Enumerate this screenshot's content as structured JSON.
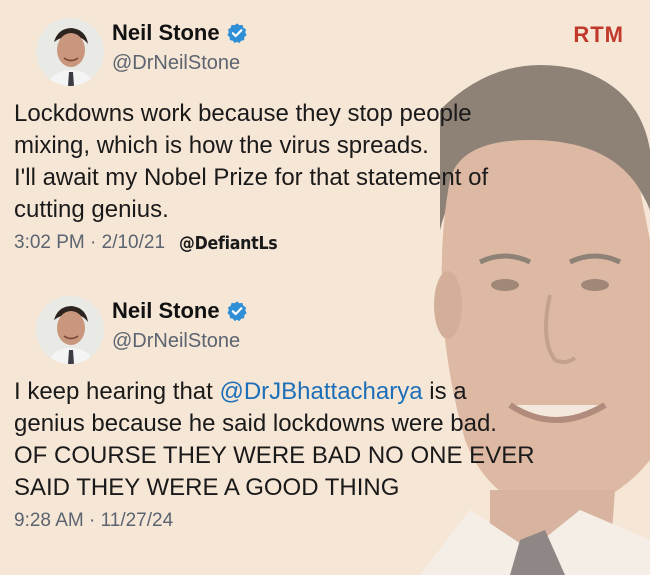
{
  "watermark": "RTM",
  "credit": "@DefiantLs",
  "colors": {
    "background": "#f6e6d6",
    "mention": "#1d6fb8",
    "verified_badge": "#2e8fd6",
    "watermark": "#c0392b",
    "secondary_text": "#5b6470"
  },
  "tweets": [
    {
      "author": {
        "name": "Neil Stone",
        "handle": "@DrNeilStone",
        "verified_icon": "verified-badge-icon"
      },
      "lines": [
        "Lockdowns work because they stop people",
        "mixing, which is how the virus spreads.",
        "I'll await my Nobel Prize for that statement of",
        "cutting genius."
      ],
      "timestamp": "3:02 PM · 2/10/21"
    },
    {
      "author": {
        "name": "Neil Stone",
        "handle": "@DrNeilStone",
        "verified_icon": "verified-badge-icon"
      },
      "line1_prefix": "I keep hearing that ",
      "line1_mention": "@DrJBhattacharya",
      "line1_suffix": " is a",
      "lines_rest": [
        "genius because he said lockdowns were bad.",
        "OF COURSE THEY WERE BAD NO ONE EVER",
        "SAID THEY WERE A GOOD THING"
      ],
      "timestamp": "9:28 AM · 11/27/24"
    }
  ]
}
